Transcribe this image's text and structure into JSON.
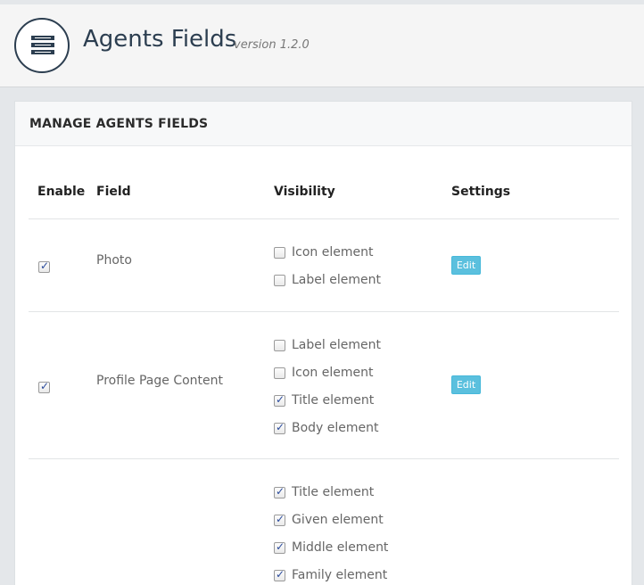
{
  "header": {
    "title": "Agents Fields",
    "version": "version 1.2.0",
    "logo_icon": "server-icon"
  },
  "panel": {
    "heading": "MANAGE AGENTS FIELDS",
    "columns": [
      "Enable",
      "Field",
      "Visibility",
      "Settings"
    ]
  },
  "rows": [
    {
      "enabled": true,
      "field": "Photo",
      "visibility": [
        {
          "label": "Icon element",
          "checked": false
        },
        {
          "label": "Label element",
          "checked": false
        }
      ],
      "edit_label": "Edit"
    },
    {
      "enabled": true,
      "field": "Profile Page Content",
      "visibility": [
        {
          "label": "Label element",
          "checked": false
        },
        {
          "label": "Icon element",
          "checked": false
        },
        {
          "label": "Title element",
          "checked": true
        },
        {
          "label": "Body element",
          "checked": true
        }
      ],
      "edit_label": "Edit"
    },
    {
      "visibility": [
        {
          "label": "Title element",
          "checked": true
        },
        {
          "label": "Given element",
          "checked": true
        },
        {
          "label": "Middle element",
          "checked": true
        },
        {
          "label": "Family element",
          "checked": true
        }
      ]
    }
  ],
  "colors": {
    "brand": "#2c3e50",
    "edit_button": "#5bc0de",
    "check": "#2a4a9b"
  }
}
